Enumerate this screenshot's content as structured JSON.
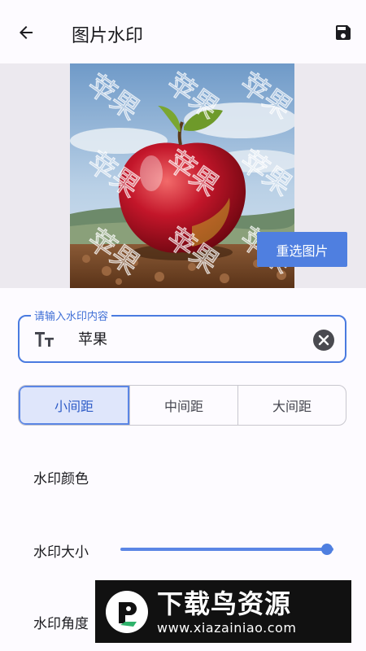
{
  "appbar": {
    "back_icon": "arrow-left-icon",
    "title": "图片水印",
    "save_icon": "floppy-disk-icon"
  },
  "preview": {
    "image_description_icon": "apple-photo",
    "watermark_text": "苹果",
    "reselect_label": "重选图片"
  },
  "text_field": {
    "label": "请输入水印内容",
    "value": "苹果",
    "leading_icon": "text-format-icon",
    "trailing_icon": "clear-icon"
  },
  "spacing": {
    "options": [
      "小间距",
      "中间距",
      "大间距"
    ],
    "selected_index": 0
  },
  "settings": {
    "color_label": "水印颜色",
    "size_label": "水印大小",
    "size_value": 0.97,
    "angle_label": "水印角度"
  },
  "overlay_banner": {
    "title": "下载鸟资源",
    "url": "www.xiazainiao.com"
  },
  "colors": {
    "accent": "#4f7fe0",
    "segment_selected_bg": "#dfe6fb",
    "preview_bg": "#ece9ef"
  }
}
